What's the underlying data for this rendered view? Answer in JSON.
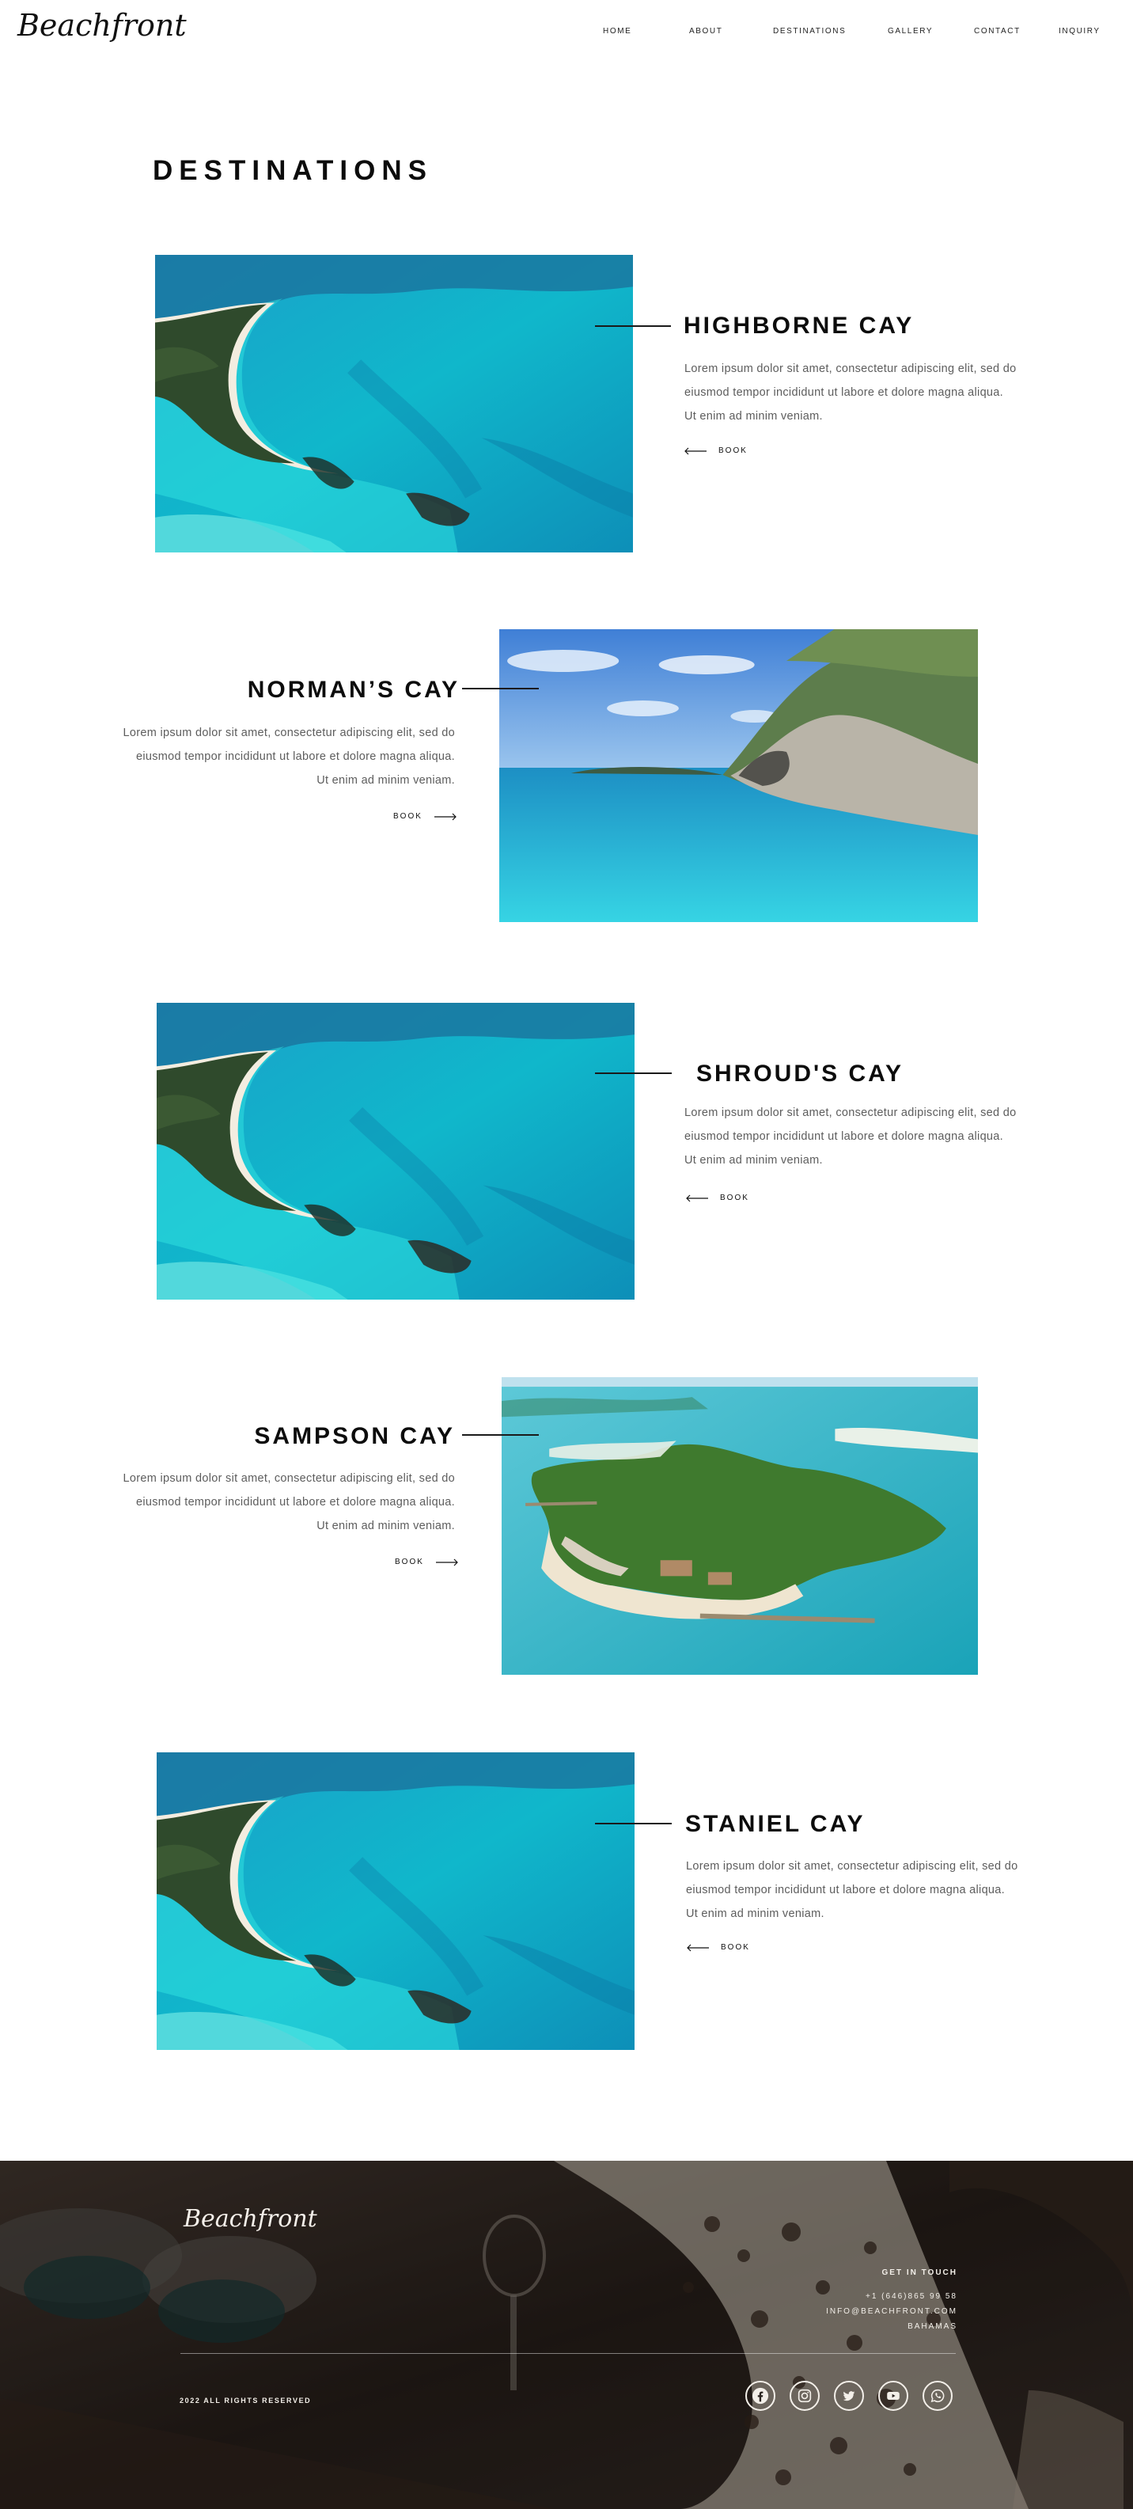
{
  "brand": {
    "logo_text": "Beachfront"
  },
  "nav": {
    "items": [
      {
        "label": "HOME"
      },
      {
        "label": "ABOUT"
      },
      {
        "label": "DESTINATIONS"
      },
      {
        "label": "GALLERY"
      },
      {
        "label": "CONTACT"
      },
      {
        "label": "INQUIRY"
      }
    ]
  },
  "page": {
    "title": "DESTINATIONS"
  },
  "destinations": [
    {
      "name": "HIGHBORNE CAY",
      "description": "Lorem ipsum dolor sit amet, consectetur adipiscing elit, sed do eiusmod tempor incididunt ut labore et dolore magna aliqua. Ut enim ad minim veniam.",
      "cta": "BOOK",
      "photo": "aerial-beach"
    },
    {
      "name": "NORMAN’S CAY",
      "description": "Lorem ipsum dolor sit amet, consectetur adipiscing elit, sed do eiusmod tempor incididunt ut labore et dolore magna aliqua. Ut enim ad minim veniam.",
      "cta": "BOOK",
      "photo": "rocky-cove"
    },
    {
      "name": "SHROUD'S CAY",
      "description": "Lorem ipsum dolor sit amet, consectetur adipiscing elit, sed do eiusmod tempor incididunt ut labore et dolore magna aliqua. Ut enim ad minim veniam.",
      "cta": "BOOK",
      "photo": "aerial-beach"
    },
    {
      "name": "SAMPSON CAY",
      "description": "Lorem ipsum dolor sit amet, consectetur adipiscing elit, sed do eiusmod tempor incididunt ut labore et dolore magna aliqua. Ut enim ad minim veniam.",
      "cta": "BOOK",
      "photo": "island-resort"
    },
    {
      "name": "STANIEL CAY",
      "description": "Lorem ipsum dolor sit amet, consectetur adipiscing elit, sed do eiusmod tempor incididunt ut labore et dolore magna aliqua. Ut enim ad minim veniam.",
      "cta": "BOOK",
      "photo": "aerial-beach"
    }
  ],
  "footer": {
    "logo_text": "Beachfront",
    "contact_heading": "GET IN TOUCH",
    "phone": "+1 (646)865 99 58",
    "email": "INFO@BEACHFRONT.COM",
    "location": "BAHAMAS",
    "copyright": "2022 ALL RIGHTS RESERVED",
    "social_icons": [
      "facebook-icon",
      "instagram-icon",
      "twitter-icon",
      "youtube-icon",
      "whatsapp-icon"
    ]
  },
  "colors": {
    "text": "#0c0c0c",
    "body_text": "#5d5d5d",
    "ocean": "#19c2cf",
    "footer_bg": "#2b2420"
  }
}
